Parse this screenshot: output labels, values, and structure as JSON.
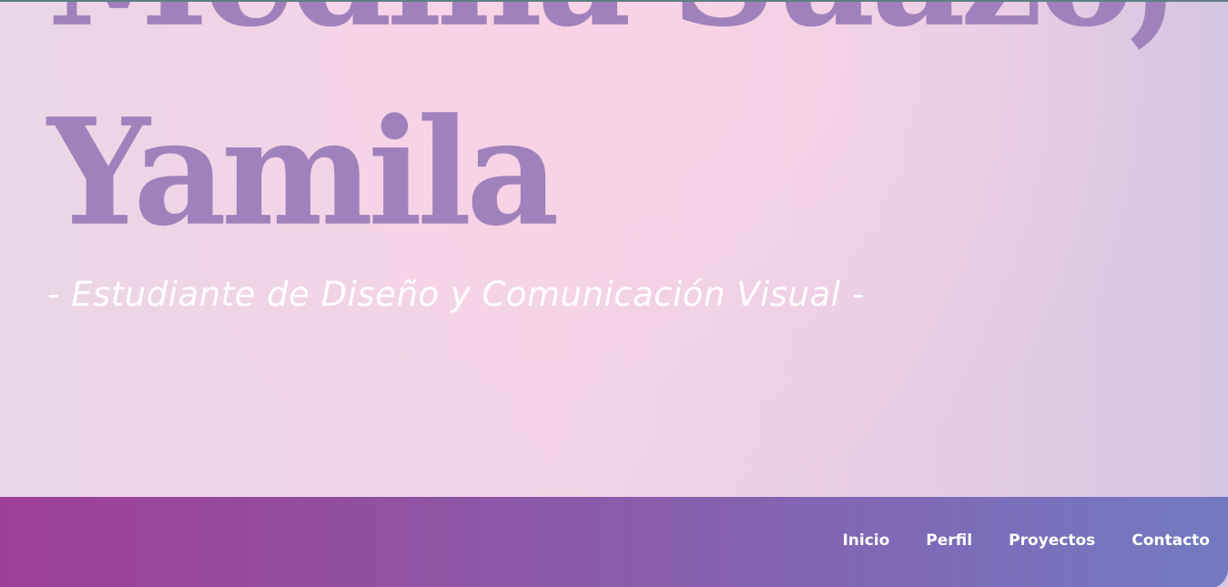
{
  "hero": {
    "name_line_1": "Medina Suazo,",
    "name_line_2": "Yamila",
    "subtitle": "- Estudiante de Diseño y Comunicación Visual -"
  },
  "nav": {
    "links": [
      {
        "label": "Inicio"
      },
      {
        "label": "Perfil"
      },
      {
        "label": "Proyectos"
      },
      {
        "label": "Contacto"
      }
    ]
  },
  "colors": {
    "name_text": "#9f82bb",
    "subtitle_text": "#ffffff",
    "navbar_start": "#9e3f97",
    "navbar_end": "#737ac1",
    "hero_pink": "#f8d3e5",
    "hero_lavender": "#d6c5e2"
  }
}
